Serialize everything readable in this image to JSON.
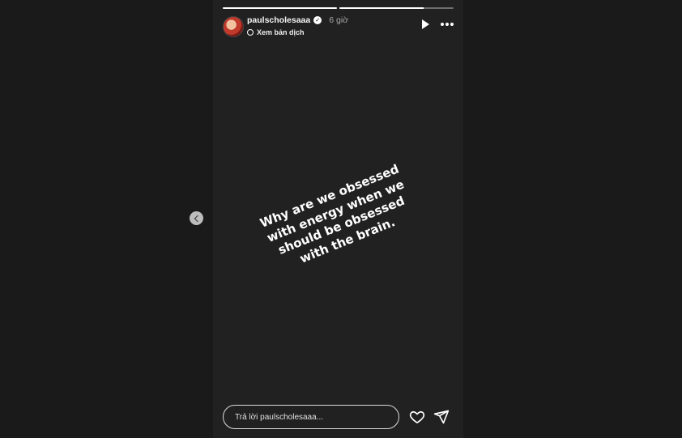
{
  "story": {
    "progress": [
      1.0,
      0.74
    ],
    "username": "paulscholesaaa",
    "time": "6 giờ",
    "translate_label": "Xem bản dịch",
    "quote_lines": [
      "Why are we obsessed",
      "with energy when we",
      "should be obsessed",
      "with the brain."
    ]
  },
  "reply": {
    "placeholder": "Trả lời paulscholesaaa..."
  },
  "icons": {
    "prev": "chevron-left-icon",
    "play": "play-icon",
    "more": "more-icon",
    "heart": "heart-icon",
    "send": "send-icon",
    "translate": "translate-icon"
  }
}
